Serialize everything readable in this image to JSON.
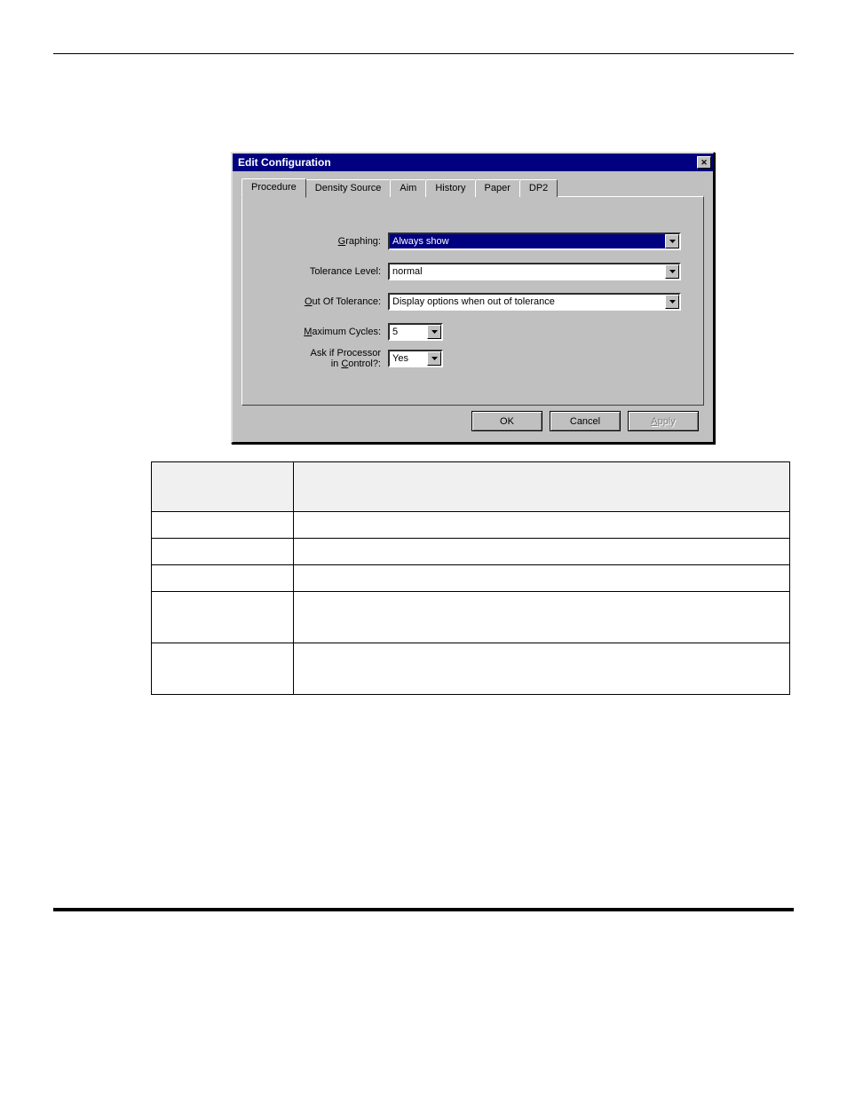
{
  "dialog": {
    "title": "Edit Configuration",
    "tabs": [
      {
        "label": "Procedure",
        "active": true
      },
      {
        "label": "Density Source",
        "active": false
      },
      {
        "label": "Aim",
        "active": false
      },
      {
        "label": "History",
        "active": false
      },
      {
        "label": "Paper",
        "active": false
      },
      {
        "label": "DP2",
        "active": false
      }
    ],
    "fields": {
      "graphing": {
        "label_pre": "",
        "label_u": "G",
        "label_post": "raphing:",
        "value": "Always show",
        "selected": true,
        "width": "wide"
      },
      "tolerance": {
        "label_pre": "Tolerance Level:",
        "label_u": "",
        "label_post": "",
        "value": "normal",
        "selected": false,
        "width": "wide"
      },
      "out_of_tolerance": {
        "label_pre": "",
        "label_u": "O",
        "label_post": "ut Of Tolerance:",
        "value": "Display options when out of tolerance",
        "selected": false,
        "width": "wide"
      },
      "max_cycles": {
        "label_pre": "",
        "label_u": "M",
        "label_post": "aximum Cycles:",
        "value": "5",
        "selected": false,
        "width": "narrow"
      },
      "ask_processor": {
        "label_line1": "Ask if Processor",
        "label_line2_pre": "in ",
        "label_line2_u": "C",
        "label_line2_post": "ontrol?:",
        "value": "Yes",
        "selected": false,
        "width": "narrow"
      }
    },
    "buttons": {
      "ok": "OK",
      "cancel": "Cancel",
      "apply": "Apply",
      "apply_u": "A",
      "apply_rest": "pply"
    }
  }
}
